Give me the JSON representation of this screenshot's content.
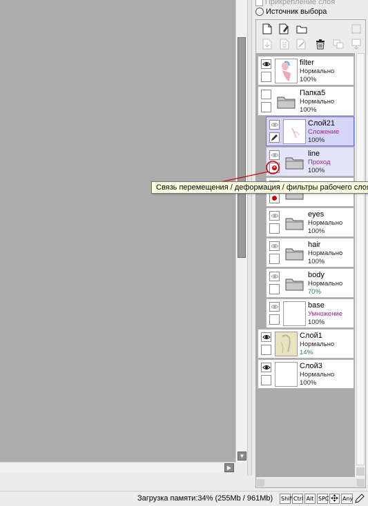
{
  "layer_options": {
    "clip_label": "Прикрепление слоя",
    "source_label": "Источник выбора"
  },
  "tooltip": {
    "text": "Связь перемещения / деформация / фильтры рабочего слоя"
  },
  "layers": [
    {
      "name": "filter",
      "mode": "Нормально",
      "opacity": "100%",
      "type": "image",
      "visible": true
    },
    {
      "name": "Папка5",
      "mode": "Нормально",
      "opacity": "100%",
      "type": "folder",
      "visible": false
    },
    {
      "name": "Слой21",
      "mode": "Сложение",
      "opacity": "100%",
      "type": "image",
      "visible": true,
      "selected": true
    },
    {
      "name": "line",
      "mode": "Проход",
      "opacity": "100%",
      "type": "folder",
      "visible": true
    },
    {
      "name": "eyes",
      "mode": "Нормально",
      "opacity": "100%",
      "type": "folder",
      "visible": true
    },
    {
      "name": "hair",
      "mode": "Нормально",
      "opacity": "100%",
      "type": "folder",
      "visible": true
    },
    {
      "name": "body",
      "mode": "Нормально",
      "opacity": "70%",
      "type": "folder",
      "visible": true
    },
    {
      "name": "base",
      "mode": "Умножение",
      "opacity": "100%",
      "type": "image",
      "visible": true
    },
    {
      "name": "Слой1",
      "mode": "Нормально",
      "opacity": "14%",
      "type": "image",
      "visible": true
    },
    {
      "name": "Слой3",
      "mode": "Нормально",
      "opacity": "100%",
      "type": "image",
      "visible": true
    }
  ],
  "status": {
    "memory": "Загрузка памяти:34% (255Mb / 961Mb)",
    "keys": [
      "Shift",
      "Ctrl",
      "Alt",
      "SPC",
      "Any"
    ]
  },
  "colors": {
    "canvas_bg": "#acacac",
    "selected_layer": "#d6d6fb",
    "mode_pink": "#a01f8e",
    "opacity_teal": "#2b7a70",
    "link_red": "#d40000",
    "tooltip_bg": "#ffffe1"
  },
  "icons": {
    "toolbar_row1": [
      "new-layer-icon",
      "new-linework-layer-icon",
      "new-folder-icon",
      "disabled-icon"
    ],
    "toolbar_row2": [
      "transfer-down-icon",
      "merge-down-icon",
      "clear-layer-icon",
      "delete-layer-icon",
      "merge-visible-icon",
      "merge-all-icon"
    ],
    "row": [
      "eye-icon",
      "pen-icon",
      "link-icon",
      "folder-icon"
    ]
  }
}
